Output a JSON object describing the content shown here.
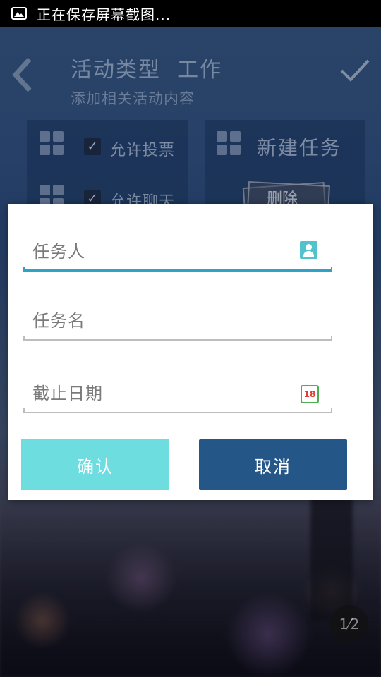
{
  "status_bar": {
    "text": "正在保存屏幕截图...",
    "icon": "picture-icon"
  },
  "background": {
    "title": "活动类型  工作",
    "subtitle": "添加相关活动内容",
    "left_card": {
      "option1": "允许投票",
      "option2": "允许聊天"
    },
    "right_card": {
      "new_task_label": "新建任务",
      "delete_label": "删除"
    },
    "page_indicator": "1⁄2"
  },
  "dialog": {
    "fields": {
      "assignee_placeholder": "任务人",
      "task_name_placeholder": "任务名",
      "deadline_placeholder": "截止日期"
    },
    "calendar_day": "18",
    "confirm_label": "确认",
    "cancel_label": "取消"
  },
  "colors": {
    "confirm_button": "#6ddde0",
    "cancel_button": "#245688",
    "active_underline": "#2fa2c6"
  }
}
